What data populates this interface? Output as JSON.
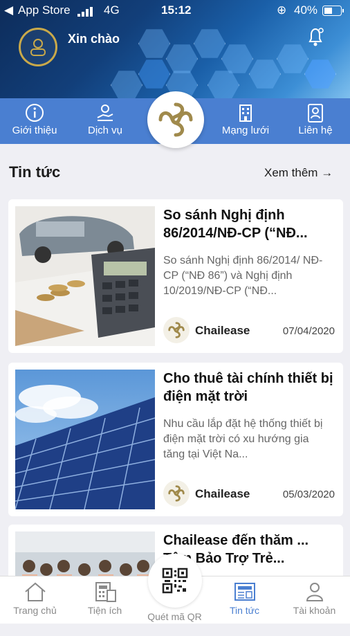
{
  "status_bar": {
    "carrier": "App Store",
    "network": "4G",
    "time": "15:12",
    "battery": "40%"
  },
  "header": {
    "greeting": "Xin chào"
  },
  "quick_menu": [
    {
      "label": "Giới thiệu",
      "icon": "info-icon"
    },
    {
      "label": "Dịch vụ",
      "icon": "service-icon"
    },
    {
      "label": "Mạng lưới",
      "icon": "building-icon"
    },
    {
      "label": "Liên hệ",
      "icon": "contact-card-icon"
    }
  ],
  "news": {
    "section_title": "Tin tức",
    "more_label": "Xem thêm →",
    "items": [
      {
        "title": "So sánh Nghị định 86/2014/NĐ-CP (“NĐ...",
        "summary": "So sánh Nghị định 86/2014/ NĐ-CP (“NĐ 86”) và Nghị định 10/2019/NĐ-CP (“NĐ...",
        "author": "Chailease",
        "date": "07/04/2020"
      },
      {
        "title": "Cho thuê tài chính thiết bị điện mặt trời",
        "summary": "Nhu cầu lắp đặt hệ thống thiết bị điện mặt trời có xu hướng gia tăng tại Việt Na...",
        "author": "Chailease",
        "date": "05/03/2020"
      },
      {
        "title": "Chailease đến thăm ... Tâm Bảo Trợ Trẻ...",
        "summary": "",
        "author": "",
        "date": ""
      }
    ]
  },
  "tab_bar": [
    {
      "label": "Trang chủ",
      "icon": "home-icon",
      "active": false
    },
    {
      "label": "Tiện ích",
      "icon": "calculator-icon",
      "active": false
    },
    {
      "label": "Quét mã QR",
      "icon": "qr-code-icon",
      "active": false
    },
    {
      "label": "Tin tức",
      "icon": "newspaper-icon",
      "active": true
    },
    {
      "label": "Tài khoản",
      "icon": "user-icon",
      "active": false
    }
  ],
  "colors": {
    "accent": "#4a7fd1",
    "gold": "#a08a4c",
    "active_tab": "#4a7fd1",
    "inactive_tab": "#8a8a8a"
  }
}
